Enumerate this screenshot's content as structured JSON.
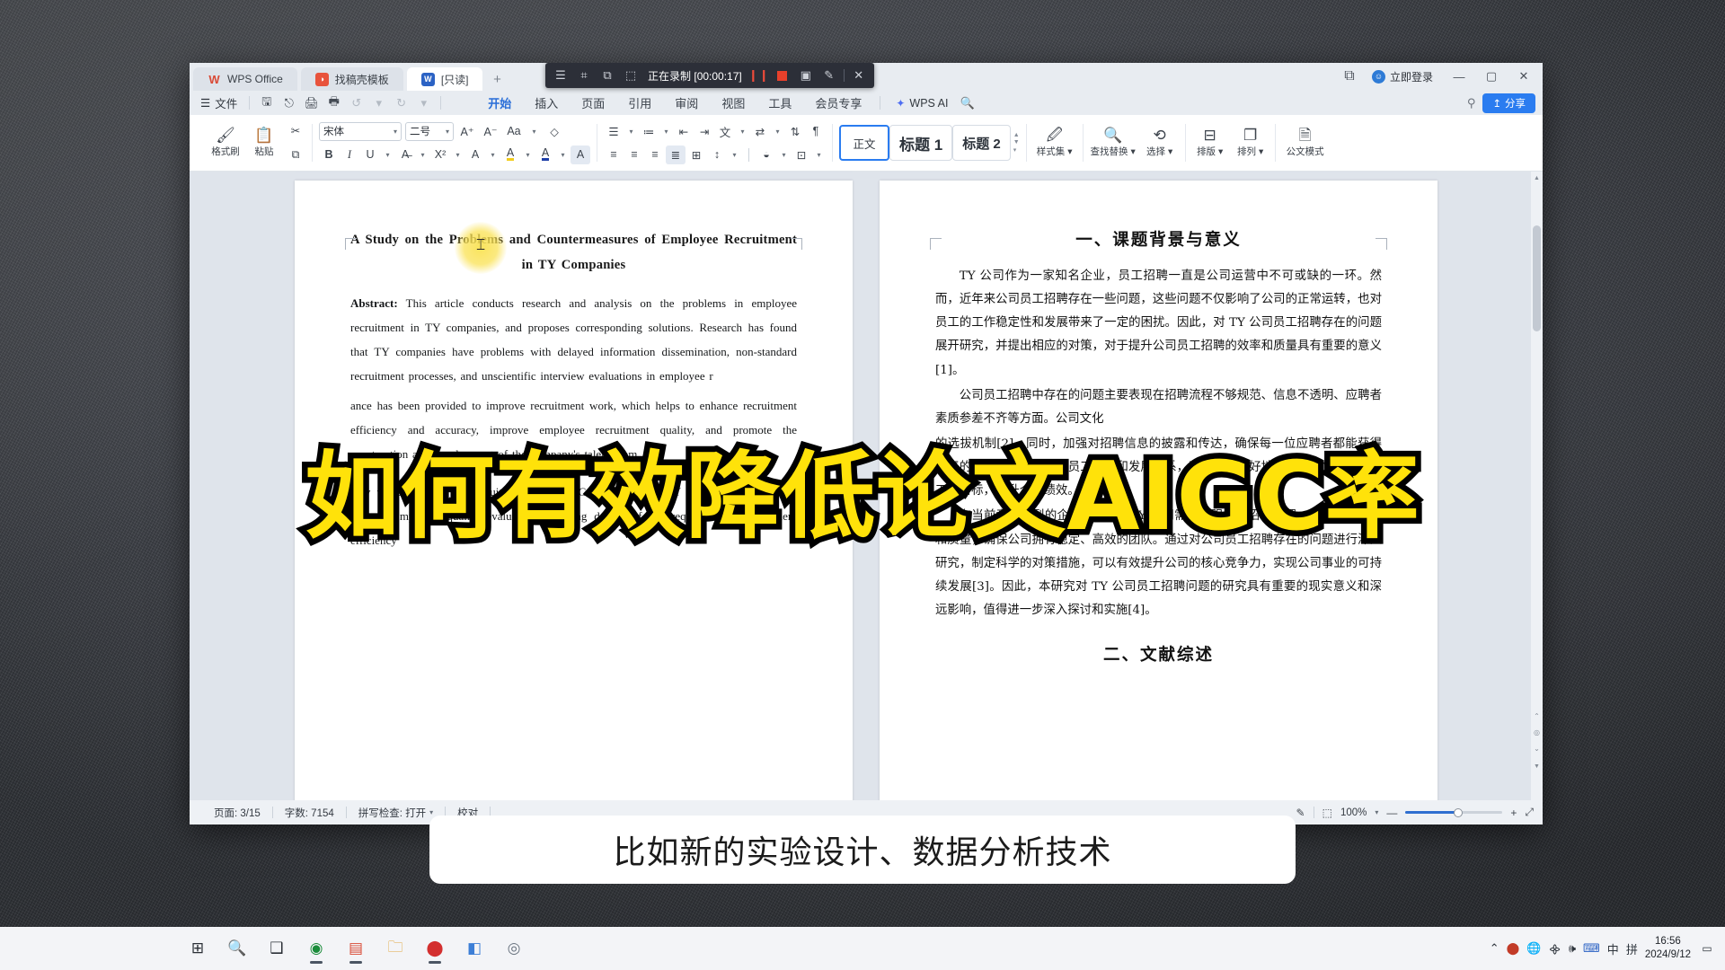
{
  "window": {
    "tabs": [
      {
        "label": "WPS Office",
        "icon": "wps-logo-icon",
        "active": false
      },
      {
        "label": "找稿壳模板",
        "icon": "template-icon",
        "active": false
      },
      {
        "label": "[只读]",
        "icon": "word-doc-icon",
        "active": true
      }
    ],
    "add_tab": "+",
    "login_label": "立即登录",
    "controls": {
      "minimize": "—",
      "maximize": "▢",
      "close": "✕",
      "restore": "⧉"
    }
  },
  "recorder": {
    "status": "正在录制",
    "timer": "[00:00:17]",
    "icons": [
      "list-icon",
      "crop-icon",
      "zoom-region-icon",
      "region-select-icon"
    ],
    "pause": "❙❙",
    "stop": "stop-icon",
    "camera": "camera-icon",
    "pen": "pen-icon",
    "close": "✕"
  },
  "quick_access": {
    "menu_icon": "hamburger-icon",
    "file_label": "文件",
    "buttons": [
      "save-icon",
      "cloud-share-icon",
      "print-icon",
      "print-preview-icon",
      "undo-icon",
      "redo-icon",
      "more-icon"
    ]
  },
  "menu_tabs": [
    {
      "label": "开始",
      "active": true
    },
    {
      "label": "插入",
      "active": false
    },
    {
      "label": "页面",
      "active": false
    },
    {
      "label": "引用",
      "active": false
    },
    {
      "label": "审阅",
      "active": false
    },
    {
      "label": "视图",
      "active": false
    },
    {
      "label": "工具",
      "active": false
    },
    {
      "label": "会员专享",
      "active": false
    }
  ],
  "wps_ai": {
    "label": "WPS AI",
    "search_icon": "search-icon"
  },
  "menu_right": {
    "share_label": "分享",
    "bulb_icon": "lightbulb-icon"
  },
  "ribbon": {
    "format_painter": "格式刷",
    "paste": "粘贴",
    "cut_icon": "scissors-icon",
    "copy_icon": "copy-icon",
    "font_name": "宋体",
    "font_size": "二号",
    "grow_font": "A⁺",
    "shrink_font": "A⁻",
    "change_case": "Aa",
    "clear_format": "clear-format-icon",
    "bold": "B",
    "italic": "I",
    "underline": "U",
    "strikethrough": "S",
    "superscript": "X²",
    "text_effects": "A",
    "highlight": "A",
    "font_color": "A",
    "char_shading": "A",
    "styles": [
      {
        "label": "正文",
        "selected": true
      },
      {
        "label": "标题 1",
        "selected": false
      },
      {
        "label": "标题 2",
        "selected": false
      }
    ],
    "style_set": "样式集",
    "find_replace": "查找替换",
    "select": "选择",
    "typeset": "排版",
    "arrange": "排列",
    "official_mode": "公文模式"
  },
  "document": {
    "title": "A Study on the Problems and Countermeasures of Employee Recruitment in TY Companies",
    "abstract_label": "Abstract:",
    "abstract_body": "This article conducts research and analysis on the problems in employee recruitment in TY companies, and proposes corresponding solutions. Research has found that TY companies have problems with delayed information dissemination, non-standard recruitment processes, and unscientific interview evaluations in employee r",
    "abstract_tail": "ance has been provided to improve recruitment work, which helps to enhance recruitment efficiency and accuracy, improve employee recruitment quality, and promote the construction and development of the company's talent team.",
    "keywords_label": "Key words:",
    "keywords_body": "Employee recruitment  Problem  Countermeasures  TY Company  Recruitment process  Employee quality evaluation  Matching degree of job requirements  Recruitment efficiency",
    "right_heading": "一、课题背景与意义",
    "right_p1": "TY 公司作为一家知名企业，员工招聘一直是公司运营中不可或缺的一环。然而，近年来公司员工招聘存在一些问题，这些问题不仅影响了公司的正常运转，也对员工的工作稳定性和发展带来了一定的困扰。因此，对 TY 公司员工招聘存在的问题展开研究，并提出相应的对策，对于提升公司员工招聘的效率和质量具有重要的意义[1]。",
    "right_p2": "公司员工招聘中存在的问题主要表现在招聘流程不够规范、信息不透明、应聘者素质参差不齐等方面。公司文化",
    "right_p3": "的选拔机制[2]。同时，加强对招聘信息的披露和传达，确保每一位应聘者都能获得公平的机会。建立完善的员工培训和发展体系，帮助员工更好地适应公司文化，明确工作目标，提升个人绩效。",
    "right_p4": "在当前竞争激烈的企业环境下，TY 公司需要加强员工招聘管理，提高招聘效率和质量，确保公司拥有稳定、高效的团队。通过对公司员工招聘存在的问题进行深入研究，制定科学的对策措施，可以有效提升公司的核心竞争力，实现公司事业的可持续发展[3]。因此，本研究对 TY 公司员工招聘问题的研究具有重要的现实意义和深远影响，值得进一步深入探讨和实施[4]。",
    "right_heading2": "二、文献综述"
  },
  "status_bar": {
    "page": "页面: 3/15",
    "words": "字数: 7154",
    "spellcheck": "拼写检查: 打开",
    "proofread": "校对",
    "zoom": "100%",
    "minus": "—",
    "plus": "+",
    "fullscreen": "fullscreen-icon",
    "pen_icon": "pen-icon",
    "layout_icon": "page-layout-icon"
  },
  "taskbar": {
    "buttons": [
      "windows-start-icon",
      "search-icon",
      "task-view-icon",
      "chrome-icon",
      "wps-icon",
      "folder-icon",
      "recorder-icon",
      "qq-icon",
      "browser-icon"
    ],
    "tray": [
      "chevron-up-icon",
      "record-dot-icon",
      "globe-icon",
      "wifi-icon",
      "volume-icon",
      "input-method-icon"
    ],
    "ime_lang": "中",
    "ime_pinyin": "拼",
    "time": "16:56",
    "date": "2024/9/12",
    "notification": "notification-icon"
  },
  "overlay": {
    "headline": "如何有效降低论文AIGC率",
    "subtitle": "比如新的实验设计、数据分析技术"
  },
  "colors": {
    "accent_blue": "#2a7cf0",
    "highlight_yellow": "#FFE20A",
    "record_red": "#e8402b"
  }
}
